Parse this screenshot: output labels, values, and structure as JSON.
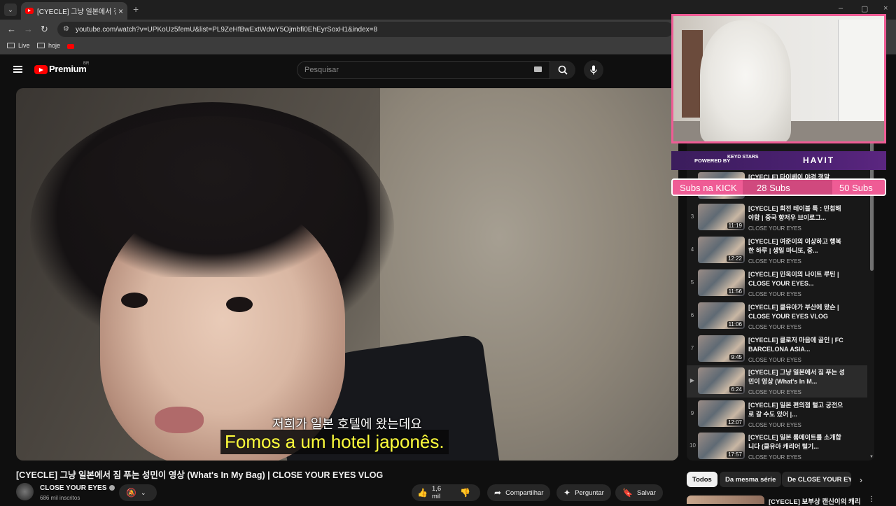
{
  "browser": {
    "tab_title": "[CYECLE] 그냥 일본에서 짐 푸는",
    "url": "youtube.com/watch?v=UPKoUz5femU&list=PL9ZeHfBwExtWdwY5Ojmbfi0EhEyrSoxH1&index=8",
    "bookmarks": [
      "Live",
      "hoje"
    ]
  },
  "header": {
    "logo_text": "Premium",
    "country_code": "BR",
    "search_placeholder": "Pesquisar"
  },
  "video": {
    "subtitle_original": "저희가 일본 호텔에 왔는데요",
    "subtitle_translated": "Fomos a um hotel japonês.",
    "title": "[CYECLE] 그냥 일본에서 짐 푸는 성민이 영상 (What's In My Bag) | CLOSE YOUR EYES VLOG",
    "channel_name": "CLOSE YOUR EYES",
    "subscribers": "686 mil inscritos",
    "like_count": "1,6 mil",
    "share_label": "Compartilhar",
    "ask_label": "Perguntar",
    "save_label": "Salvar"
  },
  "overlay": {
    "powered_by": "POWERED BY",
    "sponsor1": "KEYD STARS",
    "sponsor2": "HAVIT",
    "subs_label": "Subs na KICK",
    "subs_goal1": "28 Subs",
    "subs_goal2": "50 Subs"
  },
  "playlist": {
    "items": [
      {
        "index": "",
        "title": "[CYECLE] 타이베이 야경 정말",
        "channel": "CLOSE YOUR EYES",
        "duration": ""
      },
      {
        "index": "3",
        "title": "[CYECLE] 회전 테이블 특 : 민첩해야함 | 중국 향저우 브이로그...",
        "channel": "CLOSE YOUR EYES",
        "duration": "11:19"
      },
      {
        "index": "4",
        "title": "[CYECLE] 여준이의 이상하고 행복한 하루 | 생일 마니또, 중...",
        "channel": "CLOSE YOUR EYES",
        "duration": "12:22"
      },
      {
        "index": "5",
        "title": "[CYECLE] 민욱이의 나이트 루틴 | CLOSE YOUR EYES...",
        "channel": "CLOSE YOUR EYES",
        "duration": "11:56"
      },
      {
        "index": "6",
        "title": "[CYECLE] 클유아가 부산에 왔슨 | CLOSE YOUR EYES VLOG",
        "channel": "CLOSE YOUR EYES",
        "duration": "11:06"
      },
      {
        "index": "7",
        "title": "[CYECLE] 클로저 마음에 골인 | FC BARCELONA ASIA...",
        "channel": "CLOSE YOUR EYES",
        "duration": "9:45"
      },
      {
        "index": "▶",
        "title": "[CYECLE] 그냥 일본에서 짐 푸는 성민이 영상 (What's In M...",
        "channel": "CLOSE YOUR EYES",
        "duration": "6:24"
      },
      {
        "index": "9",
        "title": "[CYECLE] 일본 편의점 털고 궁전으로 갈 수도 있어 |...",
        "channel": "CLOSE YOUR EYES",
        "duration": "12:07"
      },
      {
        "index": "10",
        "title": "[CYECLE] 일본 룸메이트를 소개합니다 (클유아 캐리어 털기...",
        "channel": "CLOSE YOUR EYES",
        "duration": "17:57"
      }
    ]
  },
  "chips": [
    "Todos",
    "Da mesma série",
    "De CLOSE YOUR EYES"
  ],
  "recommended": {
    "first_title": "[CYECLE] 보부상 캔신이의 캐리"
  }
}
